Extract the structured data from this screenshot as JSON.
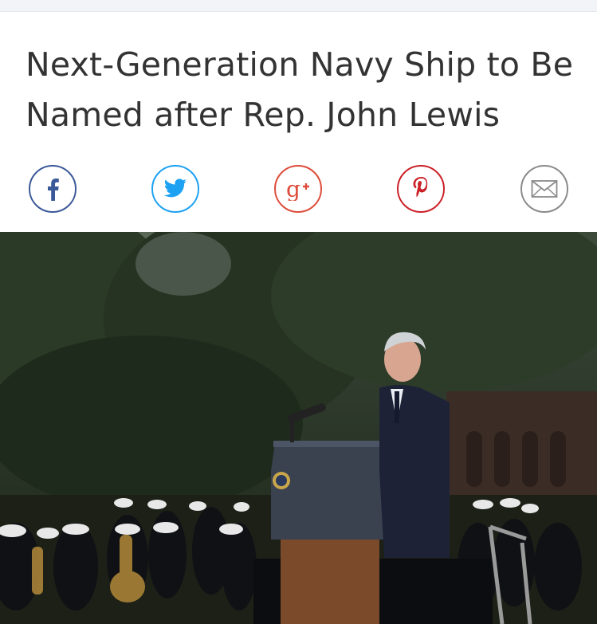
{
  "article": {
    "headline": "Next-Generation Navy Ship to Be Named after Rep. John Lewis"
  },
  "share": {
    "buttons": [
      {
        "network": "facebook",
        "icon": "facebook-icon",
        "color": "#3b5998"
      },
      {
        "network": "twitter",
        "icon": "twitter-icon",
        "color": "#1da1f2"
      },
      {
        "network": "google-plus",
        "icon": "google-plus-icon",
        "color": "#dd4b39"
      },
      {
        "network": "pinterest",
        "icon": "pinterest-icon",
        "color": "#cb2027"
      },
      {
        "network": "email",
        "icon": "mail-icon",
        "color": "#888888"
      }
    ]
  },
  "hero_image": {
    "description_icon": "photo-speaker-at-podium"
  }
}
